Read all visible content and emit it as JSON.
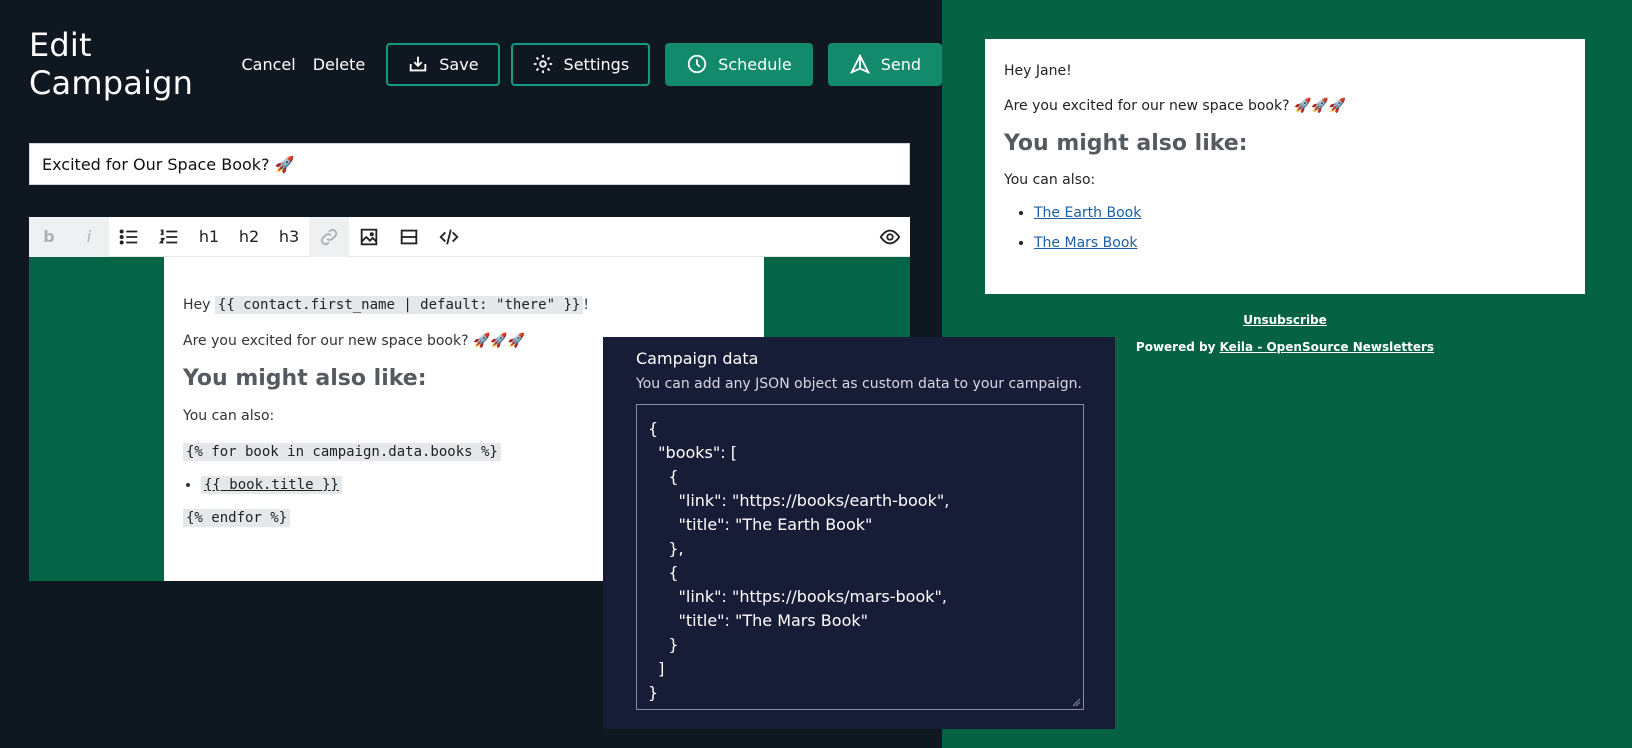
{
  "header": {
    "title": "Edit Campaign",
    "cancel": "Cancel",
    "delete": "Delete",
    "save": "Save",
    "settings": "Settings",
    "schedule": "Schedule",
    "send": "Send"
  },
  "subject": {
    "value": "Excited for Our Space Book? 🚀"
  },
  "toolbar": {
    "h1": "h1",
    "h2": "h2",
    "h3": "h3",
    "bold": "b",
    "italic": "i"
  },
  "editor": {
    "greeting_prefix": "Hey ",
    "greeting_code": "{{ contact.first_name | default: \"there\" }}",
    "greeting_suffix": "!",
    "question": "Are you excited for our new space book? 🚀🚀🚀",
    "heading": "You might also like:",
    "also": "You can also:",
    "for_tag": "{% for book in campaign.data.books %}",
    "item_tag": "{{ book.title }}",
    "endfor_tag": "{% endfor %}"
  },
  "preview": {
    "greeting": "Hey Jane!",
    "question": "Are you excited for our new space book? 🚀🚀🚀",
    "heading": "You might also like:",
    "also": "You can also:",
    "books": [
      "The Earth Book",
      "The Mars Book"
    ],
    "unsubscribe": "Unsubscribe",
    "powered_prefix": "Powered by ",
    "powered_link": "Keila - OpenSource Newsletters"
  },
  "modal": {
    "title": "Campaign data",
    "description": "You can add any JSON object as custom data to your campaign.",
    "json_lines": [
      "{",
      "  \"books\": [",
      "    {",
      "      \"link\": \"https://books/earth-book\",",
      "      \"title\": \"The Earth Book\"",
      "    },",
      "    {",
      "      \"link\": \"https://books/mars-book\",",
      "      \"title\": \"The Mars Book\"",
      "    }",
      "  ]",
      "}"
    ]
  },
  "colors": {
    "accent": "#128a6b",
    "dark_bg": "#0f1720",
    "green_bg": "#056344",
    "modal_bg": "#171c37"
  }
}
